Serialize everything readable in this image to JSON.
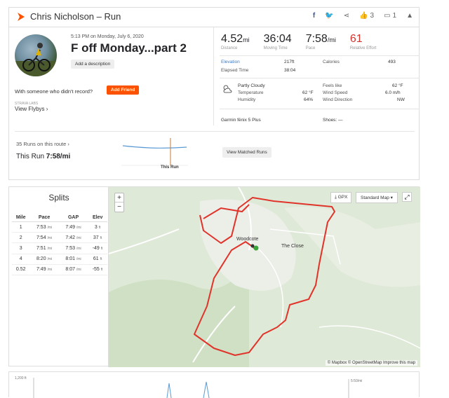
{
  "header": {
    "title": "Chris Nicholson – Run",
    "kudos_count": "3",
    "comments_count": "1"
  },
  "activity": {
    "meta": "5:13 PM on Monday, July 6, 2020",
    "name": "F off Monday...part 2",
    "add_description": "Add a description",
    "with_someone": "With someone who didn't record?",
    "add_friend": "Add Friend",
    "strava_labs": "STRAVA LABS",
    "view_flybys": "View Flybys"
  },
  "stats": [
    {
      "value": "4.52",
      "unit": "mi",
      "label": "Distance"
    },
    {
      "value": "36:04",
      "unit": "",
      "label": "Moving Time"
    },
    {
      "value": "7:58",
      "unit": "/mi",
      "label": "Pace"
    },
    {
      "value": "61",
      "unit": "",
      "label": "Relative Effort"
    }
  ],
  "details": {
    "elevation_label": "Elevation",
    "elevation": "217ft",
    "calories_label": "Calories",
    "calories": "493",
    "elapsed_label": "Elapsed Time",
    "elapsed": "38:04",
    "weather": "Partly Cloudy",
    "temperature_label": "Temperature",
    "temperature": "62 °F",
    "humidity_label": "Humidity",
    "humidity": "64%",
    "feels_label": "Feels like",
    "feels": "62 °F",
    "wind_speed_label": "Wind Speed",
    "wind_speed": "6.0 m/h",
    "wind_dir_label": "Wind Direction",
    "wind_dir": "NW",
    "device": "Garmin fēnix 5 Plus",
    "shoes": "Shoes: —"
  },
  "route": {
    "count": "35 Runs on this route",
    "this_run_label": "This Run",
    "this_run_pace": "7:58/mi",
    "chart_label": "This Run",
    "view_matched": "View Matched Runs"
  },
  "splits": {
    "title": "Splits",
    "headers": [
      "Mile",
      "Pace",
      "GAP",
      "Elev"
    ],
    "rows": [
      {
        "mile": "1",
        "pace": "7:53",
        "gap": "7:49",
        "elev": "3"
      },
      {
        "mile": "2",
        "pace": "7:54",
        "gap": "7:42",
        "elev": "37"
      },
      {
        "mile": "3",
        "pace": "7:51",
        "gap": "7:53",
        "elev": "-49"
      },
      {
        "mile": "4",
        "pace": "8:20",
        "gap": "8:01",
        "elev": "61"
      },
      {
        "mile": "0.52",
        "pace": "7:49",
        "gap": "8:07",
        "elev": "-55"
      }
    ],
    "pace_unit": "/mi",
    "elev_unit": "ft"
  },
  "map": {
    "gpx": "GPX",
    "map_type": "Standard Map",
    "place_woodcote": "Woodcote",
    "place_close": "The Close",
    "attribution": "© Mapbox © OpenStreetMap Improve this map"
  },
  "elevation_chart": {
    "y_label": "1,200 ft",
    "pace_label": "5:50/mi"
  }
}
